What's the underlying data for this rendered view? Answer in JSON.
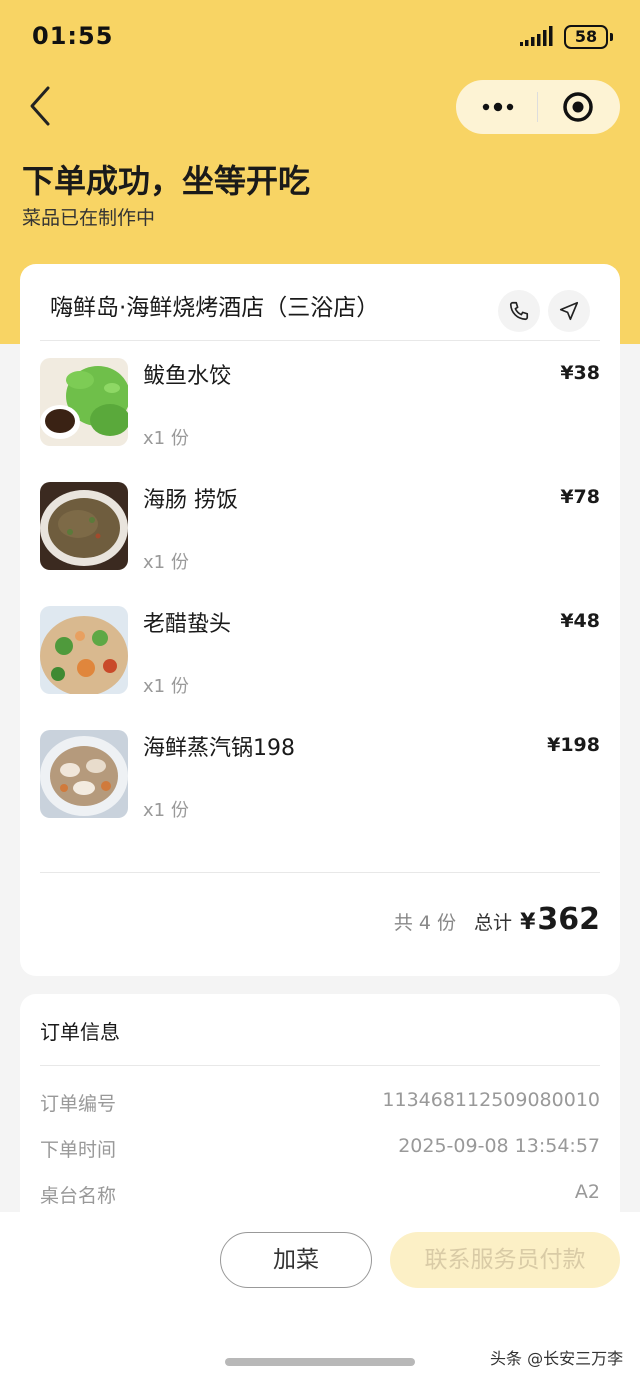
{
  "status_bar": {
    "time": "01:55",
    "battery": "58"
  },
  "header": {
    "title": "下单成功，坐等开吃",
    "subtitle": "菜品已在制作中"
  },
  "order": {
    "store_name": "嗨鲜岛·海鲜烧烤酒店（三浴店）",
    "items": [
      {
        "name": "鲅鱼水饺",
        "qty": "x1 份",
        "price": "¥38"
      },
      {
        "name": "海肠 捞饭",
        "qty": "x1 份",
        "price": "¥78"
      },
      {
        "name": "老醋蛰头",
        "qty": "x1 份",
        "price": "¥48"
      },
      {
        "name": "海鲜蒸汽锅198",
        "qty": "x1 份",
        "price": "¥198"
      }
    ],
    "summary": {
      "count": "共 4 份",
      "total_label": "总计",
      "currency": "¥",
      "total": "362"
    }
  },
  "order_info": {
    "title": "订单信息",
    "rows": [
      {
        "label": "订单编号",
        "value": "113468112509080010"
      },
      {
        "label": "下单时间",
        "value": "2025-09-08 13:54:57"
      },
      {
        "label": "桌台名称",
        "value": "A2"
      }
    ]
  },
  "actions": {
    "add_label": "加菜",
    "pay_label": "联系服务员付款"
  },
  "watermark": "头条 @长安三万李",
  "colors": {
    "header_bg": "#f8d464",
    "pay_button_bg": "#fcf0c6",
    "pay_button_text": "#d9cba6"
  }
}
